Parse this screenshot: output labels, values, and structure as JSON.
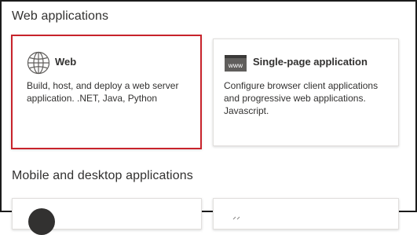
{
  "sections": {
    "web": {
      "title": "Web applications",
      "cards": [
        {
          "name": "Web",
          "icon": "globe-icon",
          "description": "Build, host, and deploy a web server application. .NET, Java, Python",
          "selected": true
        },
        {
          "name": "Single-page application",
          "icon": "www-icon",
          "description": "Configure browser client applications and progressive web applications. Javascript."
        }
      ]
    },
    "mobile": {
      "title": "Mobile and desktop applications"
    }
  },
  "colors": {
    "selected_border": "#c8232b",
    "card_border": "#e1dfdd",
    "text": "#323130",
    "www_icon": "#605e5c"
  }
}
